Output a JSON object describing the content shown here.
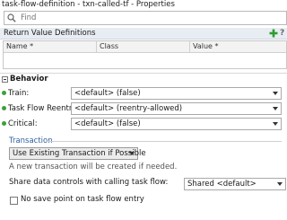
{
  "window": {
    "title": "task-flow-definition - txn-called-tf - Properties"
  },
  "search": {
    "placeholder": "Find",
    "value": ""
  },
  "return_values": {
    "section_title": "Return Value Definitions",
    "columns": [
      "Name *",
      "Class",
      "Value *"
    ],
    "rows": []
  },
  "behavior": {
    "title": "Behavior",
    "properties": [
      {
        "label": "Train:",
        "value": "<default> (false)"
      },
      {
        "label": "Task Flow Reentry:",
        "value": "<default> (reentry-allowed)"
      },
      {
        "label": "Critical:",
        "value": "<default> (false)"
      }
    ]
  },
  "transaction": {
    "legend": "Transaction",
    "mode": "Use Existing Transaction if Possible",
    "description": "A new transaction will be created if needed.",
    "share_label": "Share data controls with calling task flow:",
    "share_value": "Shared <default>",
    "no_save_point_label": "No save point on task flow entry",
    "no_save_point_checked": false
  },
  "colors": {
    "accent": "#2f5f9e",
    "add_green": "#2e9d2e",
    "required_dot": "#3aa13a"
  },
  "icons": [
    "search-icon",
    "add-icon",
    "help-icon",
    "collapse-icon",
    "chevron-down-icon"
  ]
}
